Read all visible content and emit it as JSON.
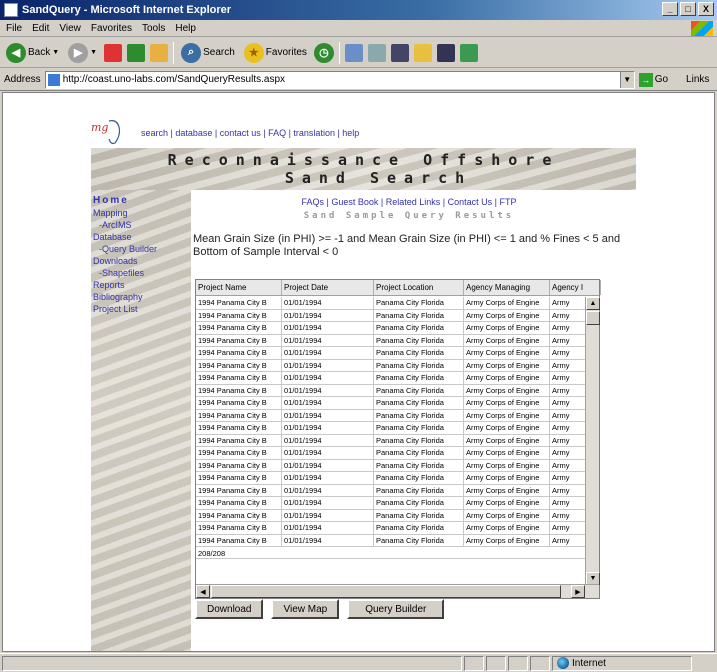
{
  "window": {
    "title": "SandQuery - Microsoft Internet Explorer",
    "controls": [
      "_",
      "□",
      "X"
    ]
  },
  "menu": [
    "File",
    "Edit",
    "View",
    "Favorites",
    "Tools",
    "Help"
  ],
  "toolbar": {
    "back_label": "Back",
    "search_label": "Search",
    "favorites_label": "Favorites"
  },
  "address": {
    "label": "Address",
    "url": "http://coast.uno-labs.com/SandQueryResults.aspx",
    "go_label": "Go",
    "links_label": "Links"
  },
  "page": {
    "toplinks": "search | database | contact us | FAQ | translation | help",
    "banner_line1": "Reconnaissance Offshore",
    "banner_line2": "Sand Search",
    "nav": [
      {
        "label": "Home",
        "style": "home"
      },
      {
        "label": "Mapping",
        "style": "top"
      },
      {
        "label": "-ArcIMS",
        "style": "sub"
      },
      {
        "label": "Database",
        "style": "top"
      },
      {
        "label": "-Query Builder",
        "style": "sub"
      },
      {
        "label": "Downloads",
        "style": "top"
      },
      {
        "label": "-Shapefiles",
        "style": "sub"
      },
      {
        "label": "Reports",
        "style": "top"
      },
      {
        "label": "Bibliography",
        "style": "top"
      },
      {
        "label": "Project List",
        "style": "top"
      }
    ],
    "main_links": "FAQs | Guest Book | Related Links | Contact Us | FTP",
    "subtitle": "Sand Sample Query Results",
    "query_text": "Mean Grain Size (in PHI) >= -1 and Mean Grain Size (in PHI) <= 1 and % Fines < 5 and Bottom of Sample Interval < 0"
  },
  "grid": {
    "columns": [
      "Project Name",
      "Project Date",
      "Project Location",
      "Agency Managing",
      "Agency I"
    ],
    "rows": [
      [
        "1994 Panama City B",
        "01/01/1994",
        "Panama City Florida",
        "Army Corps of Engine",
        "Army"
      ],
      [
        "1994 Panama City B",
        "01/01/1994",
        "Panama City Florida",
        "Army Corps of Engine",
        "Army"
      ],
      [
        "1994 Panama City B",
        "01/01/1994",
        "Panama City Florida",
        "Army Corps of Engine",
        "Army"
      ],
      [
        "1994 Panama City B",
        "01/01/1994",
        "Panama City Florida",
        "Army Corps of Engine",
        "Army"
      ],
      [
        "1994 Panama City B",
        "01/01/1994",
        "Panama City Florida",
        "Army Corps of Engine",
        "Army"
      ],
      [
        "1994 Panama City B",
        "01/01/1994",
        "Panama City Florida",
        "Army Corps of Engine",
        "Army"
      ],
      [
        "1994 Panama City B",
        "01/01/1994",
        "Panama City Florida",
        "Army Corps of Engine",
        "Army"
      ],
      [
        "1994 Panama City B",
        "01/01/1994",
        "Panama City Florida",
        "Army Corps of Engine",
        "Army"
      ],
      [
        "1994 Panama City B",
        "01/01/1994",
        "Panama City Florida",
        "Army Corps of Engine",
        "Army"
      ],
      [
        "1994 Panama City B",
        "01/01/1994",
        "Panama City Florida",
        "Army Corps of Engine",
        "Army"
      ],
      [
        "1994 Panama City B",
        "01/01/1994",
        "Panama City Florida",
        "Army Corps of Engine",
        "Army"
      ],
      [
        "1994 Panama City B",
        "01/01/1994",
        "Panama City Florida",
        "Army Corps of Engine",
        "Army"
      ],
      [
        "1994 Panama City B",
        "01/01/1994",
        "Panama City Florida",
        "Army Corps of Engine",
        "Army"
      ],
      [
        "1994 Panama City B",
        "01/01/1994",
        "Panama City Florida",
        "Army Corps of Engine",
        "Army"
      ],
      [
        "1994 Panama City B",
        "01/01/1994",
        "Panama City Florida",
        "Army Corps of Engine",
        "Army"
      ],
      [
        "1994 Panama City B",
        "01/01/1994",
        "Panama City Florida",
        "Army Corps of Engine",
        "Army"
      ],
      [
        "1994 Panama City B",
        "01/01/1994",
        "Panama City Florida",
        "Army Corps of Engine",
        "Army"
      ],
      [
        "1994 Panama City B",
        "01/01/1994",
        "Panama City Florida",
        "Army Corps of Engine",
        "Army"
      ],
      [
        "1994 Panama City B",
        "01/01/1994",
        "Panama City Florida",
        "Army Corps of Engine",
        "Army"
      ],
      [
        "1994 Panama City B",
        "01/01/1994",
        "Panama City Florida",
        "Army Corps of Engine",
        "Army"
      ]
    ],
    "footer": "208/208"
  },
  "buttons": {
    "download": "Download",
    "view_map": "View Map",
    "query_builder": "Query Builder"
  },
  "status": {
    "zone": "Internet"
  }
}
